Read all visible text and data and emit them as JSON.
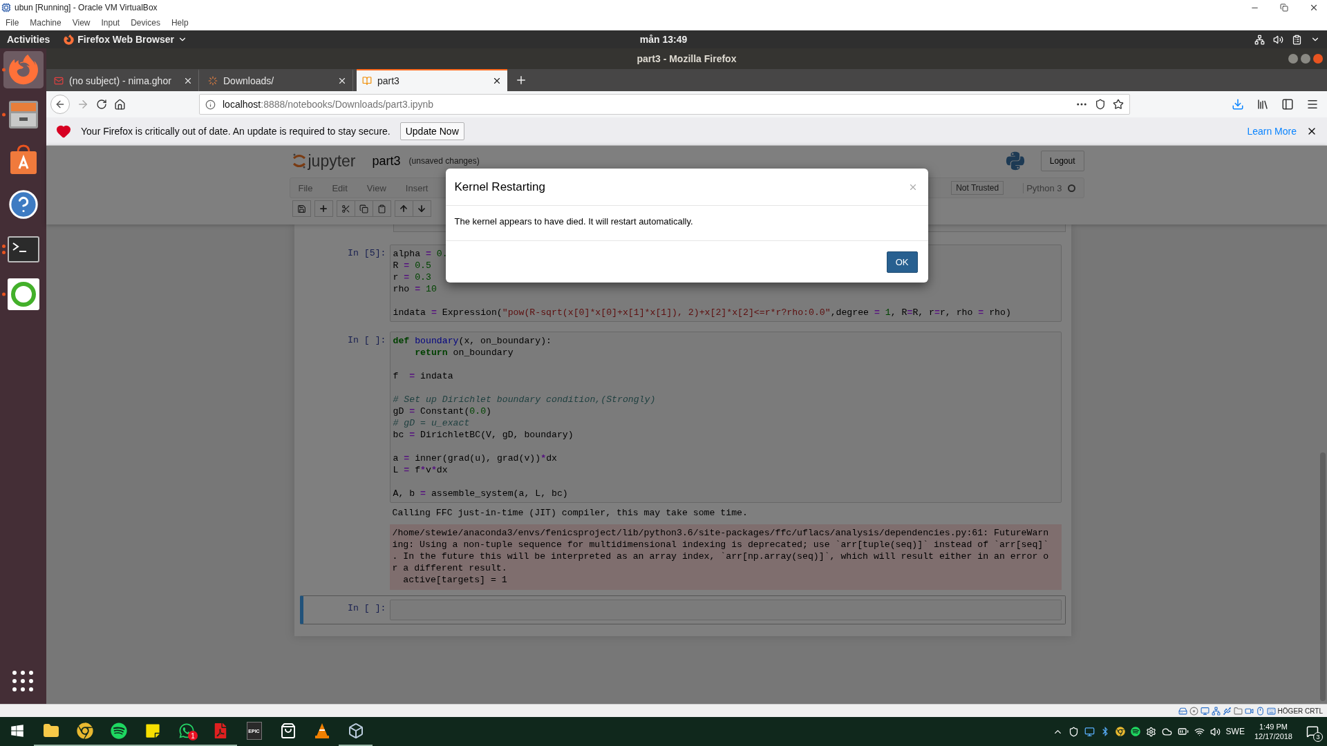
{
  "vm_window": {
    "title": "ubun [Running] - Oracle VM VirtualBox",
    "menu": [
      "File",
      "Machine",
      "View",
      "Input",
      "Devices",
      "Help"
    ]
  },
  "top_bar": {
    "activities": "Activities",
    "app_menu": "Firefox Web Browser",
    "clock": "mån 13:49"
  },
  "dock": {
    "items": [
      {
        "kind": "firefox",
        "selected": true,
        "running": true,
        "multiple": false
      },
      {
        "kind": "files",
        "selected": false,
        "running": true,
        "multiple": false
      },
      {
        "kind": "software",
        "selected": false,
        "running": false
      },
      {
        "kind": "help",
        "selected": false,
        "running": false
      },
      {
        "kind": "terminal",
        "selected": false,
        "running": true,
        "multiple": true
      },
      {
        "kind": "anaconda",
        "selected": false,
        "running": true,
        "multiple": false
      }
    ]
  },
  "browser": {
    "title": "part3 - Mozilla Firefox",
    "tabs": [
      {
        "label": "(no subject) - nima.ghor",
        "kind": "mail",
        "selected": false
      },
      {
        "label": "Downloads/",
        "kind": "loading",
        "selected": false
      },
      {
        "label": "part3",
        "kind": "notebook",
        "selected": true
      }
    ],
    "url": {
      "host": "localhost",
      "path": ":8888/notebooks/Downloads/part3.ipynb"
    },
    "notification": {
      "message": "Your Firefox is critically out of date. An update is required to stay secure.",
      "button": "Update Now",
      "link": "Learn More"
    }
  },
  "notebook": {
    "logo": "jupyter",
    "name": "part3",
    "status": "(unsaved changes)",
    "logout": "Logout",
    "menu": [
      "File",
      "Edit",
      "View",
      "Insert"
    ],
    "trusted": "Not Trusted",
    "kernel": "Python 3",
    "kernel_busy": false,
    "cells": [
      {
        "prompt": "In [5]:",
        "selected": false,
        "lines": [
          {
            "kind": "code",
            "tokens": [
              {
                "text": "alpha",
                "kind": "plain"
              },
              {
                "text": " = ",
                "kind": "operator"
              },
              {
                "text": "0.",
                "kind": "number"
              }
            ]
          },
          {
            "kind": "code",
            "tokens": [
              {
                "text": "R",
                "kind": "plain"
              },
              {
                "text": " = ",
                "kind": "operator"
              },
              {
                "text": "0.5",
                "kind": "number"
              }
            ]
          },
          {
            "kind": "code",
            "tokens": [
              {
                "text": "r",
                "kind": "plain"
              },
              {
                "text": " = ",
                "kind": "operator"
              },
              {
                "text": "0.3",
                "kind": "number"
              }
            ]
          },
          {
            "kind": "code",
            "tokens": [
              {
                "text": "rho",
                "kind": "plain"
              },
              {
                "text": " = ",
                "kind": "operator"
              },
              {
                "text": "10",
                "kind": "number"
              }
            ]
          },
          {
            "kind": "blank"
          },
          {
            "kind": "code",
            "tokens": [
              {
                "text": "indata",
                "kind": "plain"
              },
              {
                "text": " = ",
                "kind": "operator"
              },
              {
                "text": "Expression(",
                "kind": "plain"
              },
              {
                "text": "\"pow(R-sqrt(x[0]*x[0]+x[1]*x[1]), 2)+x[2]*x[2]<=r*r?rho:0.0\"",
                "kind": "string"
              },
              {
                "text": ",degree",
                "kind": "plain"
              },
              {
                "text": " = ",
                "kind": "operator"
              },
              {
                "text": "1",
                "kind": "number"
              },
              {
                "text": ", R",
                "kind": "plain"
              },
              {
                "text": "=",
                "kind": "operator"
              },
              {
                "text": "R, r",
                "kind": "plain"
              },
              {
                "text": "=",
                "kind": "operator"
              },
              {
                "text": "r, rho",
                "kind": "plain"
              },
              {
                "text": " = ",
                "kind": "operator"
              },
              {
                "text": "rho)",
                "kind": "plain"
              }
            ]
          }
        ]
      },
      {
        "prompt": "In [ ]:",
        "selected": false,
        "lines": [
          {
            "kind": "code",
            "tokens": [
              {
                "text": "def ",
                "kind": "keyword"
              },
              {
                "text": "boundary",
                "kind": "function"
              },
              {
                "text": "(x, on_boundary):",
                "kind": "plain"
              }
            ]
          },
          {
            "kind": "code",
            "tokens": [
              {
                "text": "    return",
                "kind": "keyword"
              },
              {
                "text": " on_boundary",
                "kind": "plain"
              }
            ]
          },
          {
            "kind": "blank"
          },
          {
            "kind": "code",
            "tokens": [
              {
                "text": "f  ",
                "kind": "plain"
              },
              {
                "text": "=",
                "kind": "operator"
              },
              {
                "text": " indata",
                "kind": "plain"
              }
            ]
          },
          {
            "kind": "blank"
          },
          {
            "kind": "code",
            "tokens": [
              {
                "text": "# Set up Dirichlet boundary condition,(Strongly)",
                "kind": "comment"
              }
            ]
          },
          {
            "kind": "code",
            "tokens": [
              {
                "text": "gD",
                "kind": "plain"
              },
              {
                "text": " = ",
                "kind": "operator"
              },
              {
                "text": "Constant(",
                "kind": "plain"
              },
              {
                "text": "0.0",
                "kind": "number"
              },
              {
                "text": ")",
                "kind": "plain"
              }
            ]
          },
          {
            "kind": "code",
            "tokens": [
              {
                "text": "# gD = u_exact",
                "kind": "comment"
              }
            ]
          },
          {
            "kind": "code",
            "tokens": [
              {
                "text": "bc",
                "kind": "plain"
              },
              {
                "text": " = ",
                "kind": "operator"
              },
              {
                "text": "DirichletBC(V, gD, boundary)",
                "kind": "plain"
              }
            ]
          },
          {
            "kind": "blank"
          },
          {
            "kind": "code",
            "tokens": [
              {
                "text": "a",
                "kind": "plain"
              },
              {
                "text": " = ",
                "kind": "operator"
              },
              {
                "text": "inner(grad(u), grad(v))",
                "kind": "plain"
              },
              {
                "text": "*",
                "kind": "operator"
              },
              {
                "text": "dx",
                "kind": "plain"
              }
            ]
          },
          {
            "kind": "code",
            "tokens": [
              {
                "text": "L",
                "kind": "plain"
              },
              {
                "text": " = ",
                "kind": "operator"
              },
              {
                "text": "f",
                "kind": "plain"
              },
              {
                "text": "*",
                "kind": "operator"
              },
              {
                "text": "v",
                "kind": "plain"
              },
              {
                "text": "*",
                "kind": "operator"
              },
              {
                "text": "dx",
                "kind": "plain"
              }
            ]
          },
          {
            "kind": "blank"
          },
          {
            "kind": "code",
            "tokens": [
              {
                "text": "A, b",
                "kind": "plain"
              },
              {
                "text": " = ",
                "kind": "operator"
              },
              {
                "text": "assemble_system(a, L, bc)",
                "kind": "plain"
              }
            ]
          }
        ],
        "outputs": [
          {
            "kind": "stream",
            "lines": [
              "Calling FFC just-in-time (JIT) compiler, this may take some time."
            ]
          },
          {
            "kind": "stderr",
            "lines": [
              "/home/stewie/anaconda3/envs/fenicsproject/lib/python3.6/site-packages/ffc/uflacs/analysis/dependencies.py:61: FutureWarn",
              "ing: Using a non-tuple sequence for multidimensional indexing is deprecated; use `arr[tuple(seq)]` instead of `arr[seq]`",
              ". In the future this will be interpreted as an array index, `arr[np.array(seq)]`, which will result either in an error o",
              "r a different result.",
              "  active[targets] = 1"
            ]
          }
        ]
      },
      {
        "prompt": "In [ ]:",
        "selected": true
      }
    ]
  },
  "dialog": {
    "title": "Kernel Restarting",
    "message": "The kernel appears to have died. It will restart automatically.",
    "button": "OK"
  },
  "vm_status": {
    "host_key": "HÖGER CRTL"
  },
  "taskbar": {
    "apps": [
      {
        "kind": "explorer",
        "running": true
      },
      {
        "kind": "chrome",
        "running": true
      },
      {
        "kind": "spotify",
        "running": true
      },
      {
        "kind": "sticky",
        "running": true
      },
      {
        "kind": "whatsapp",
        "running": true,
        "badge": "1"
      },
      {
        "kind": "acrobat",
        "running": true
      },
      {
        "kind": "epic",
        "running": false,
        "label": "EPIC"
      },
      {
        "kind": "store",
        "running": false
      },
      {
        "kind": "vlc",
        "running": false
      },
      {
        "kind": "virtualbox",
        "running": true
      }
    ],
    "language": "SWE",
    "time": "1:49 PM",
    "date": "12/17/2018",
    "notifications": "3"
  }
}
